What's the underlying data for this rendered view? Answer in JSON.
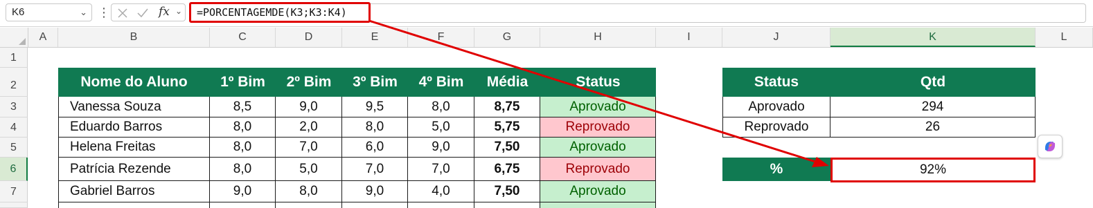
{
  "formula_bar": {
    "name_box": "K6",
    "formula": "=PORCENTAGEMDE(K3;K3:K4)",
    "fx_label": "fx"
  },
  "columns": [
    "A",
    "B",
    "C",
    "D",
    "E",
    "F",
    "G",
    "H",
    "I",
    "J",
    "K",
    "L"
  ],
  "rows": [
    "1",
    "2",
    "3",
    "4",
    "5",
    "6",
    "7"
  ],
  "main_table": {
    "headers": [
      "Nome do Aluno",
      "1º Bim",
      "2º Bim",
      "3º Bim",
      "4º Bim",
      "Média",
      "Status"
    ],
    "rows": [
      {
        "name": "Vanessa Souza",
        "b1": "8,5",
        "b2": "9,0",
        "b3": "9,5",
        "b4": "8,0",
        "media": "8,75",
        "status": "Aprovado"
      },
      {
        "name": "Eduardo Barros",
        "b1": "8,0",
        "b2": "2,0",
        "b3": "8,0",
        "b4": "5,0",
        "media": "5,75",
        "status": "Reprovado"
      },
      {
        "name": "Helena Freitas",
        "b1": "8,0",
        "b2": "7,0",
        "b3": "6,0",
        "b4": "9,0",
        "media": "7,50",
        "status": "Aprovado"
      },
      {
        "name": "Patrícia Rezende",
        "b1": "8,0",
        "b2": "5,0",
        "b3": "7,0",
        "b4": "7,0",
        "media": "6,75",
        "status": "Reprovado"
      },
      {
        "name": "Gabriel Barros",
        "b1": "9,0",
        "b2": "8,0",
        "b3": "9,0",
        "b4": "4,0",
        "media": "7,50",
        "status": "Aprovado"
      }
    ]
  },
  "summary_table": {
    "headers": [
      "Status",
      "Qtd"
    ],
    "rows": [
      {
        "status": "Aprovado",
        "qtd": "294"
      },
      {
        "status": "Reprovado",
        "qtd": "26"
      }
    ],
    "pct_label": "%",
    "pct_value": "92%"
  },
  "colors": {
    "header_green": "#107a52",
    "approved_fill": "#c6efce",
    "approved_text": "#006100",
    "failed_fill": "#ffc7ce",
    "failed_text": "#9c0006",
    "highlight_red": "#e00000"
  }
}
